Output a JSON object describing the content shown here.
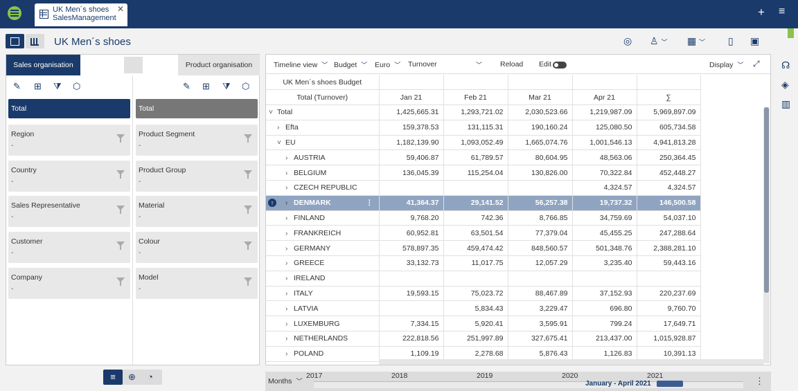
{
  "tab": {
    "line1": "UK Men´s shoes",
    "line2": "SalesManagement",
    "close": "✕"
  },
  "topbar": {
    "plus": "+",
    "menu": "≡"
  },
  "page": {
    "title": "UK Men´s shoes"
  },
  "left_panel": {
    "tab_sales": "Sales organisation",
    "tab_product": "Product organisation",
    "sales_total": "Total",
    "product_total": "Total",
    "sales_dims": [
      {
        "label": "Region",
        "value": "-"
      },
      {
        "label": "Country",
        "value": "-"
      },
      {
        "label": "Sales Representative",
        "value": "-"
      },
      {
        "label": "Customer",
        "value": "-"
      },
      {
        "label": "Company",
        "value": "-"
      }
    ],
    "product_dims": [
      {
        "label": "Product Segment",
        "value": "-"
      },
      {
        "label": "Product Group",
        "value": "-"
      },
      {
        "label": "Material",
        "value": "-"
      },
      {
        "label": "Colour",
        "value": "-"
      },
      {
        "label": "Model",
        "value": "-"
      }
    ]
  },
  "grid_toolbar": {
    "timeline_view": "Timeline view",
    "budget": "Budget",
    "currency": "Euro",
    "measure": "Turnover",
    "reload": "Reload",
    "edit": "Edit",
    "display": "Display"
  },
  "grid": {
    "title": "UK Men´s shoes Budget",
    "row_header": "Total (Turnover)",
    "columns": [
      "Jan 21",
      "Feb 21",
      "Mar 21",
      "Apr 21",
      "∑"
    ],
    "rows": [
      {
        "label": "Total",
        "chev": "˅",
        "indent": 0,
        "values": [
          "1,425,665.31",
          "1,293,721.02",
          "2,030,523.66",
          "1,219,987.09",
          "5,969,897.09"
        ]
      },
      {
        "label": "Efta",
        "chev": "›",
        "indent": 1,
        "values": [
          "159,378.53",
          "131,115.31",
          "190,160.24",
          "125,080.50",
          "605,734.58"
        ]
      },
      {
        "label": "EU",
        "chev": "˅",
        "indent": 1,
        "values": [
          "1,182,139.90",
          "1,093,052.49",
          "1,665,074.76",
          "1,001,546.13",
          "4,941,813.28"
        ]
      },
      {
        "label": "AUSTRIA",
        "chev": "›",
        "indent": 2,
        "values": [
          "59,406.87",
          "61,789.57",
          "80,604.95",
          "48,563.06",
          "250,364.45"
        ]
      },
      {
        "label": "BELGIUM",
        "chev": "›",
        "indent": 2,
        "values": [
          "136,045.39",
          "115,254.04",
          "130,826.00",
          "70,322.84",
          "452,448.27"
        ]
      },
      {
        "label": "CZECH REPUBLIC",
        "chev": "›",
        "indent": 2,
        "values": [
          "",
          "",
          "",
          "4,324.57",
          "4,324.57"
        ]
      },
      {
        "label": "DENMARK",
        "chev": "›",
        "indent": 2,
        "selected": true,
        "values": [
          "41,364.37",
          "29,141.52",
          "56,257.38",
          "19,737.32",
          "146,500.58"
        ]
      },
      {
        "label": "FINLAND",
        "chev": "›",
        "indent": 2,
        "values": [
          "9,768.20",
          "742.36",
          "8,766.85",
          "34,759.69",
          "54,037.10"
        ]
      },
      {
        "label": "FRANKREICH",
        "chev": "›",
        "indent": 2,
        "values": [
          "60,952.81",
          "63,501.54",
          "77,379.04",
          "45,455.25",
          "247,288.64"
        ]
      },
      {
        "label": "GERMANY",
        "chev": "›",
        "indent": 2,
        "values": [
          "578,897.35",
          "459,474.42",
          "848,560.57",
          "501,348.76",
          "2,388,281.10"
        ]
      },
      {
        "label": "GREECE",
        "chev": "›",
        "indent": 2,
        "values": [
          "33,132.73",
          "11,017.75",
          "12,057.29",
          "3,235.40",
          "59,443.16"
        ]
      },
      {
        "label": "IRELAND",
        "chev": "›",
        "indent": 2,
        "values": [
          "",
          "",
          "",
          "",
          ""
        ]
      },
      {
        "label": "ITALY",
        "chev": "›",
        "indent": 2,
        "values": [
          "19,593.15",
          "75,023.72",
          "88,467.89",
          "37,152.93",
          "220,237.69"
        ]
      },
      {
        "label": "LATVIA",
        "chev": "›",
        "indent": 2,
        "values": [
          "",
          "5,834.43",
          "3,229.47",
          "696.80",
          "9,760.70"
        ]
      },
      {
        "label": "LUXEMBURG",
        "chev": "›",
        "indent": 2,
        "values": [
          "7,334.15",
          "5,920.41",
          "3,595.91",
          "799.24",
          "17,649.71"
        ]
      },
      {
        "label": "NETHERLANDS",
        "chev": "›",
        "indent": 2,
        "values": [
          "222,818.56",
          "251,997.89",
          "327,675.41",
          "213,437.00",
          "1,015,928.87"
        ]
      },
      {
        "label": "POLAND",
        "chev": "›",
        "indent": 2,
        "values": [
          "1,109.19",
          "2,278.68",
          "5,876.43",
          "1,126.83",
          "10,391.13"
        ]
      }
    ]
  },
  "timeline": {
    "granularity": "Months",
    "years": [
      "2017",
      "2018",
      "2019",
      "2020",
      "2021"
    ],
    "selection": "January - April 2021",
    "more": "⋮"
  },
  "colors": {
    "primary": "#1a3a6b",
    "accent": "#8bc34a",
    "selected_row": "#8fa4c0"
  }
}
